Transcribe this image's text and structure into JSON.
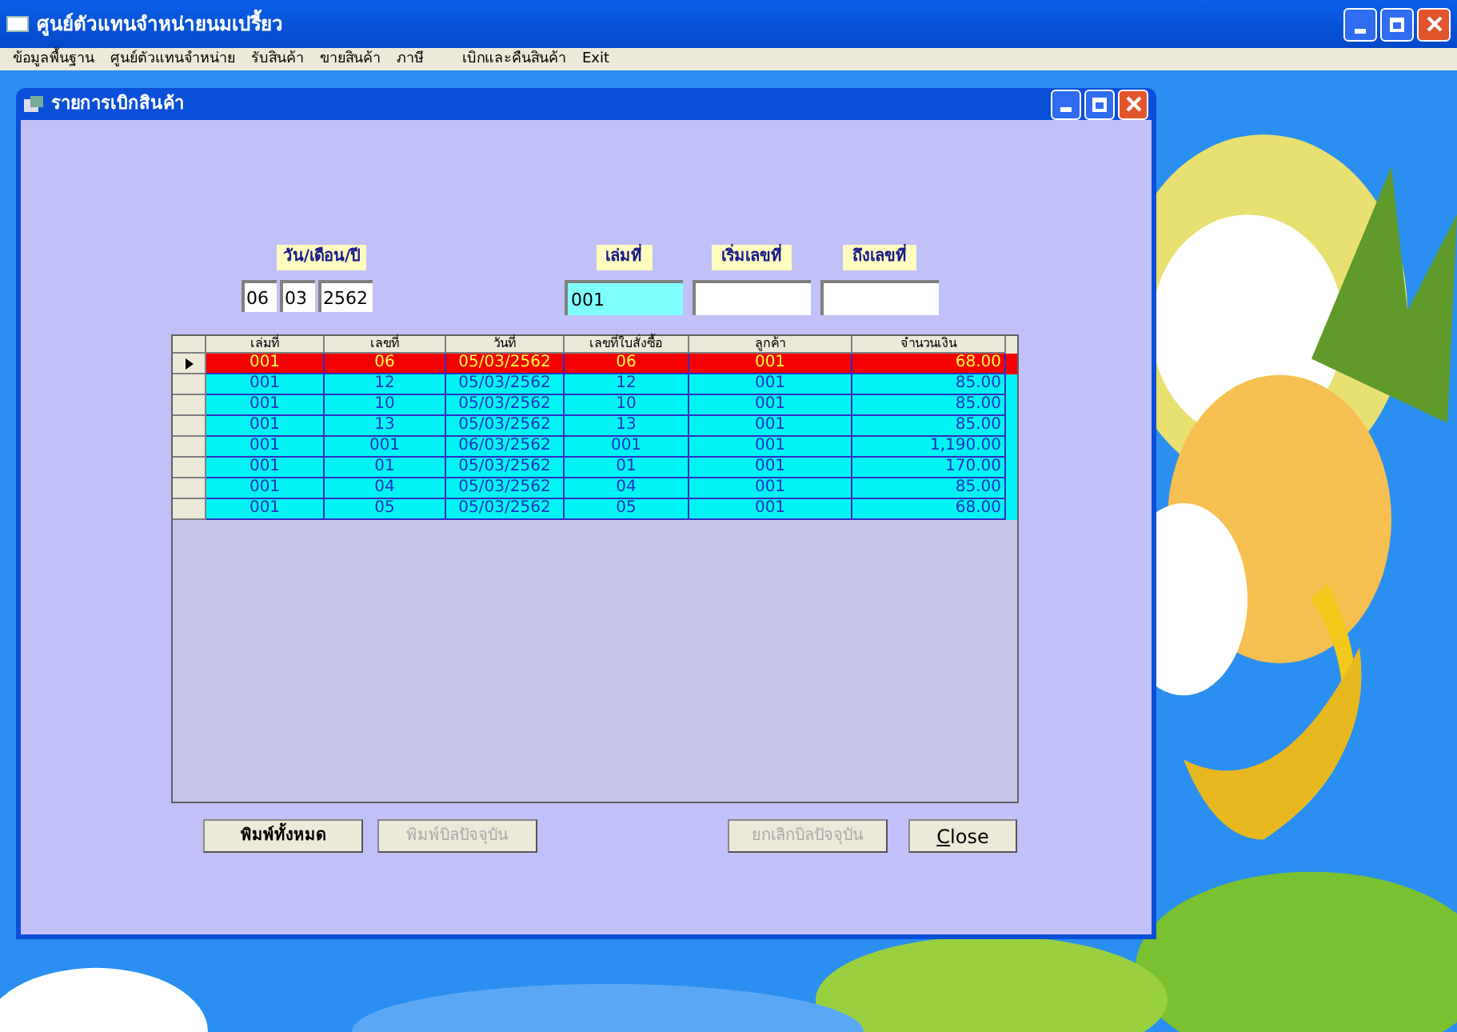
{
  "window": {
    "title": "ศูนย์ตัวแทนจำหน่ายนมเปรี้ยว"
  },
  "menu": [
    "ข้อมูลพื้นฐาน",
    "ศูนย์ตัวแทนจำหน่าย",
    "รับสินค้า",
    "ขายสินค้า",
    "ภาษี",
    "เบิกและคืนสินค้า",
    "Exit"
  ],
  "child_window": {
    "title": "รายการเบิกสินค้า",
    "date": {
      "label": "วัน/เดือน/ปี",
      "day": "06",
      "month": "03",
      "year": "2562"
    },
    "filters": [
      {
        "label": "เล่มที่",
        "value": "001",
        "focused": true
      },
      {
        "label": "เริ่มเลขที่",
        "focused": false
      },
      {
        "label": "ถึงเลขที่",
        "focused": false
      }
    ],
    "table": {
      "columns": [
        "เล่มที่",
        "เลขที่",
        "วันที่",
        "เลขที่ใบสั่งซื้อ",
        "ลูกค้า",
        "จำนวนเงิน"
      ],
      "rows": [
        {
          "selected": true,
          "cells": [
            "001",
            "06",
            "05/03/2562",
            "06",
            "001",
            "68.00"
          ]
        },
        {
          "selected": false,
          "cells": [
            "001",
            "12",
            "05/03/2562",
            "12",
            "001",
            "85.00"
          ]
        },
        {
          "selected": false,
          "cells": [
            "001",
            "10",
            "05/03/2562",
            "10",
            "001",
            "85.00"
          ]
        },
        {
          "selected": false,
          "cells": [
            "001",
            "13",
            "05/03/2562",
            "13",
            "001",
            "85.00"
          ]
        },
        {
          "selected": false,
          "cells": [
            "001",
            "001",
            "06/03/2562",
            "001",
            "001",
            "1,190.00"
          ]
        },
        {
          "selected": false,
          "cells": [
            "001",
            "01",
            "05/03/2562",
            "01",
            "001",
            "170.00"
          ]
        },
        {
          "selected": false,
          "cells": [
            "001",
            "04",
            "05/03/2562",
            "04",
            "001",
            "85.00"
          ]
        },
        {
          "selected": false,
          "cells": [
            "001",
            "05",
            "05/03/2562",
            "05",
            "001",
            "68.00"
          ]
        }
      ]
    },
    "buttons": [
      {
        "label": "พิมพ์ทั้งหมด",
        "disabled": false
      },
      {
        "label": "พิมพ์บิลปัจจุบัน",
        "disabled": true
      },
      {
        "label": "ยกเลิกบิลปัจจุบัน",
        "disabled": true
      },
      {
        "label": "Close",
        "disabled": false
      }
    ]
  }
}
